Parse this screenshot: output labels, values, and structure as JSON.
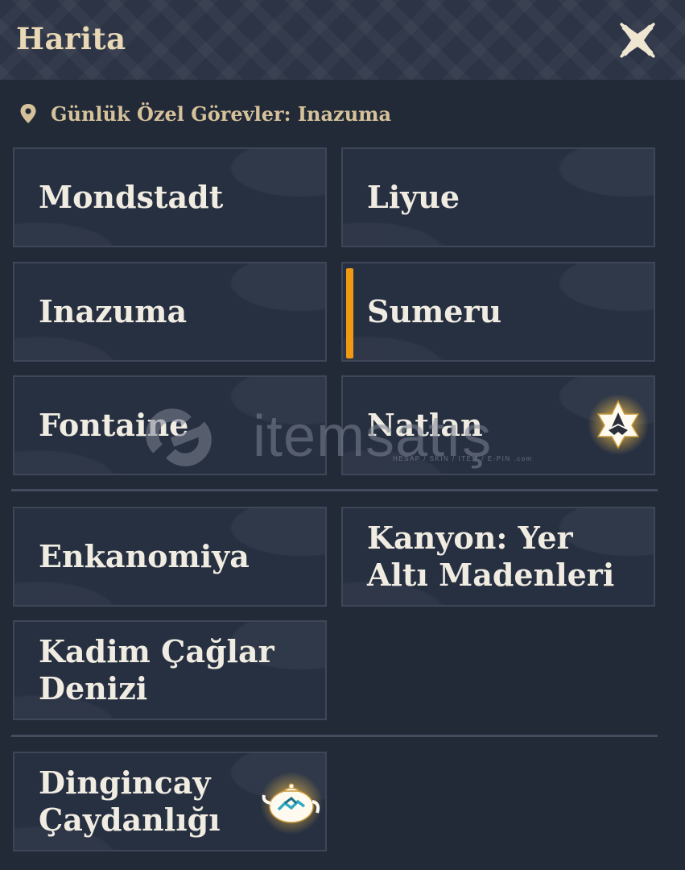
{
  "header": {
    "title": "Harita",
    "close_icon": "close-icon"
  },
  "subtitle": {
    "icon": "location-pin-icon",
    "text": "Günlük Özel Görevler: Inazuma"
  },
  "tiles": [
    {
      "label": "Mondstadt"
    },
    {
      "label": "Liyue"
    },
    {
      "label": "Inazuma"
    },
    {
      "label": "Sumeru",
      "selected": true
    },
    {
      "label": "Fontaine"
    },
    {
      "label": "Natlan",
      "icon": "natlan-emblem-icon"
    },
    {
      "label": "Enkanomiya"
    },
    {
      "label": "Kanyon: Yer Altı Madenleri"
    },
    {
      "label": "Kadim Çağlar Denizi"
    },
    {
      "label": "Dingincay Çaydanlığı",
      "icon": "teapot-icon"
    }
  ],
  "watermark": {
    "text": "itemsatış",
    "subtext": "HESAP / SKIN / ITEM / E-PIN",
    "suffix": ".com"
  },
  "colors": {
    "accent": "#f09a14",
    "title_gold": "#e9d8b5",
    "label": "#f0ece2",
    "panel_bg": "#222a38",
    "tile_bg": "#273041",
    "tile_border": "#3e4758"
  }
}
